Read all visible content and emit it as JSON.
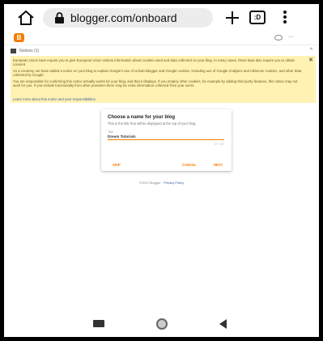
{
  "browser": {
    "url": "blogger.com/onboard",
    "tab_count": ":D"
  },
  "blogger_bar": {
    "logo_letter": "B"
  },
  "notices": {
    "label": "Notices (1)",
    "paragraphs": [
      "European Union laws require you to give European Union visitors information about cookies used and data collected on your blog. In many cases, these laws also require you to obtain consent.",
      "As a courtesy, we have added a notice on your blog to explain Google's use of certain Blogger and Google cookies, including use of Google Analytics and AdSense cookies, and other data collected by Google.",
      "You are responsible for confirming this notice actually works for your blog, and that it displays. If you employ other cookies, for example by adding third party features, this notice may not work for you. If you include functionality from other providers there may be extra information collected from your users."
    ],
    "learn_more": "Learn more about this notice and your responsibilities."
  },
  "dialog": {
    "title": "Choose a name for your blog",
    "subtitle": "This is the title that will be displayed at the top of your blog.",
    "field_label": "Title",
    "title_value": "Dream Tutorials",
    "char_count": "15 / 100",
    "skip_label": "SKIP",
    "cancel_label": "CANCEL",
    "next_label": "NEXT"
  },
  "footer": {
    "text": "©2022 Blogger · ",
    "privacy_link": "Privacy Policy"
  },
  "colors": {
    "accent": "#f57d00",
    "notice_bg": "#fff2b3",
    "link": "#3d5a9c"
  }
}
